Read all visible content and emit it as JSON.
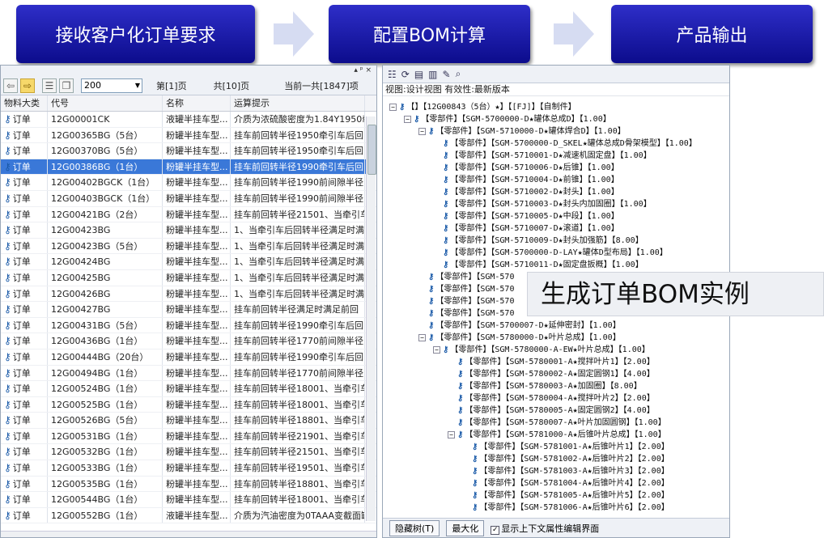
{
  "flow": {
    "step1": "接收客户化订单要求",
    "step2": "配置BOM计算",
    "step3": "产品输出"
  },
  "left": {
    "title_glyphs": "▴ ᵖ ×",
    "page_size": "200",
    "page_cur": "第[1]页",
    "page_total": "共[10]页",
    "record_count": "当前一共[1847]项",
    "columns": [
      "物料大类",
      "代号",
      "名称",
      "运算提示"
    ],
    "rows": [
      {
        "type": "订单",
        "code": "12G00001CK",
        "name": "液罐半挂车型...",
        "hint": "介质为浓硫酸密度为1.84Y1950牵"
      },
      {
        "type": "订单",
        "code": "12G00365BG（5台）",
        "name": "粉罐半挂车型...",
        "hint": "挂车前回转半径1950牵引车后回"
      },
      {
        "type": "订单",
        "code": "12G00370BG（5台）",
        "name": "粉罐半挂车型...",
        "hint": "挂车前回转半径1950牵引车后回"
      },
      {
        "type": "订单",
        "code": "12G00386BG（1台）",
        "name": "粉罐半挂车型...",
        "hint": "挂车前回转半径1990牵引车后回"
      },
      {
        "type": "订单",
        "code": "12G00402BGCK（1台）",
        "name": "粉罐半挂车型...",
        "hint": "挂车前回转半径1990前间隙半径"
      },
      {
        "type": "订单",
        "code": "12G00403BGCK（1台）",
        "name": "粉罐半挂车型...",
        "hint": "挂车前回转半径1990前间隙半径"
      },
      {
        "type": "订单",
        "code": "12G00421BG（2台）",
        "name": "粉罐半挂车型...",
        "hint": "挂车前回转半径21501、当牵引车"
      },
      {
        "type": "订单",
        "code": "12G00423BG",
        "name": "粉罐半挂车型...",
        "hint": "1、当牵引车后回转半径满足时满"
      },
      {
        "type": "订单",
        "code": "12G00423BG（5台）",
        "name": "粉罐半挂车型...",
        "hint": "1、当牵引车后回转半径满足时满"
      },
      {
        "type": "订单",
        "code": "12G00424BG",
        "name": "粉罐半挂车型...",
        "hint": "1、当牵引车后回转半径满足时满"
      },
      {
        "type": "订单",
        "code": "12G00425BG",
        "name": "粉罐半挂车型...",
        "hint": "1、当牵引车后回转半径满足时满"
      },
      {
        "type": "订单",
        "code": "12G00426BG",
        "name": "粉罐半挂车型...",
        "hint": "1、当牵引车后回转半径满足时满"
      },
      {
        "type": "订单",
        "code": "12G00427BG",
        "name": "粉罐半挂车型...",
        "hint": "挂车前回转半径满足时满足前回"
      },
      {
        "type": "订单",
        "code": "12G00431BG（5台）",
        "name": "粉罐半挂车型...",
        "hint": "挂车前回转半径1990牵引车后回"
      },
      {
        "type": "订单",
        "code": "12G00436BG（1台）",
        "name": "粉罐半挂车型...",
        "hint": "挂车前回转半径1770前间隙半径"
      },
      {
        "type": "订单",
        "code": "12G00444BG（20台）",
        "name": "粉罐半挂车型...",
        "hint": "挂车前回转半径1990牵引车后回"
      },
      {
        "type": "订单",
        "code": "12G00494BG（1台）",
        "name": "粉罐半挂车型...",
        "hint": "挂车前回转半径1770前间隙半径"
      },
      {
        "type": "订单",
        "code": "12G00524BG（1台）",
        "name": "粉罐半挂车型...",
        "hint": "挂车前回转半径18001、当牵引车"
      },
      {
        "type": "订单",
        "code": "12G00525BG（1台）",
        "name": "粉罐半挂车型...",
        "hint": "挂车前回转半径18001、当牵引车"
      },
      {
        "type": "订单",
        "code": "12G00526BG（5台）",
        "name": "粉罐半挂车型...",
        "hint": "挂车前回转半径18801、当牵引车"
      },
      {
        "type": "订单",
        "code": "12G00531BG（1台）",
        "name": "粉罐半挂车型...",
        "hint": "挂车前回转半径21901、当牵引车"
      },
      {
        "type": "订单",
        "code": "12G00532BG（1台）",
        "name": "粉罐半挂车型...",
        "hint": "挂车前回转半径21501、当牵引车"
      },
      {
        "type": "订单",
        "code": "12G00533BG（1台）",
        "name": "粉罐半挂车型...",
        "hint": "挂车前回转半径19501、当牵引车"
      },
      {
        "type": "订单",
        "code": "12G00535BG（1台）",
        "name": "粉罐半挂车型...",
        "hint": "挂车前回转半径18801、当牵引车"
      },
      {
        "type": "订单",
        "code": "12G00544BG（1台）",
        "name": "粉罐半挂车型...",
        "hint": "挂车前回转半径18001、当牵引车"
      },
      {
        "type": "订单",
        "code": "12G00552BG（1台）",
        "name": "液罐半挂车型...",
        "hint": "介质为汽油密度为0TAAA变截面罐"
      }
    ]
  },
  "right": {
    "info": "视图:设计视图 有效性:最新版本",
    "tree": [
      {
        "d": 0,
        "e": "−",
        "t": "【】【12G00843（5台）★】【[FJ]】【自制件】"
      },
      {
        "d": 1,
        "e": "−",
        "t": "【零部件】【SGM-5700000-D★罐体总成D】【1.00】"
      },
      {
        "d": 2,
        "e": "−",
        "t": "【零部件】【SGM-5710000-D★罐体焊合D】【1.00】"
      },
      {
        "d": 3,
        "e": "",
        "t": "【零部件】【SGM-5700000-D_SKEL★罐体总成D骨架模型】【1.00】"
      },
      {
        "d": 3,
        "e": "",
        "t": "【零部件】【SGM-5710001-D★减速机固定盘】【1.00】"
      },
      {
        "d": 3,
        "e": "",
        "t": "【零部件】【SGM-5710006-D★后锥】【1.00】"
      },
      {
        "d": 3,
        "e": "",
        "t": "【零部件】【SGM-5710004-D★前锥】【1.00】"
      },
      {
        "d": 3,
        "e": "",
        "t": "【零部件】【SGM-5710002-D★封头】【1.00】"
      },
      {
        "d": 3,
        "e": "",
        "t": "【零部件】【SGM-5710003-D★封头内加固圈】【1.00】"
      },
      {
        "d": 3,
        "e": "",
        "t": "【零部件】【SGM-5710005-D★中段】【1.00】"
      },
      {
        "d": 3,
        "e": "",
        "t": "【零部件】【SGM-5710007-D★滚道】【1.00】"
      },
      {
        "d": 3,
        "e": "",
        "t": "【零部件】【SGM-5710009-D★封头加强筋】【8.00】"
      },
      {
        "d": 3,
        "e": "",
        "t": "【零部件】【SGM-5700000-D-LAY★罐体D型布局】【1.00】"
      },
      {
        "d": 3,
        "e": "",
        "t": "【零部件】【SGM-5710011-D★固定盘扳概】【1.00】"
      },
      {
        "d": 2,
        "e": "",
        "t": "【零部件】【SGM-570"
      },
      {
        "d": 2,
        "e": "",
        "t": "【零部件】【SGM-570"
      },
      {
        "d": 2,
        "e": "",
        "t": "【零部件】【SGM-570"
      },
      {
        "d": 2,
        "e": "",
        "t": "【零部件】【SGM-570"
      },
      {
        "d": 2,
        "e": "",
        "t": "【零部件】【SGM-5700007-D★延伸密封】【1.00】"
      },
      {
        "d": 2,
        "e": "−",
        "t": "【零部件】【SGM-5780000-D★叶片总成】【1.00】"
      },
      {
        "d": 3,
        "e": "−",
        "t": "【零部件】【SGM-5780000-A-EW★叶片总成】【1.00】"
      },
      {
        "d": 4,
        "e": "",
        "t": "【零部件】【SGM-5780001-A★搅拌叶片1】【2.00】"
      },
      {
        "d": 4,
        "e": "",
        "t": "【零部件】【SGM-5780002-A★固定圆钢1】【4.00】"
      },
      {
        "d": 4,
        "e": "",
        "t": "【零部件】【SGM-5780003-A★加固圈】【8.00】"
      },
      {
        "d": 4,
        "e": "",
        "t": "【零部件】【SGM-5780004-A★搅拌叶片2】【2.00】"
      },
      {
        "d": 4,
        "e": "",
        "t": "【零部件】【SGM-5780005-A★固定圆钢2】【4.00】"
      },
      {
        "d": 4,
        "e": "",
        "t": "【零部件】【SGM-5780007-A★叶片加固圆钢】【1.00】"
      },
      {
        "d": 4,
        "e": "−",
        "t": "【零部件】【SGM-5781000-A★后锥叶片总成】【1.00】"
      },
      {
        "d": 5,
        "e": "",
        "t": "【零部件】【SGM-5781001-A★后锥叶片1】【2.00】"
      },
      {
        "d": 5,
        "e": "",
        "t": "【零部件】【SGM-5781002-A★后锥叶片2】【2.00】"
      },
      {
        "d": 5,
        "e": "",
        "t": "【零部件】【SGM-5781003-A★后锥叶片3】【2.00】"
      },
      {
        "d": 5,
        "e": "",
        "t": "【零部件】【SGM-5781004-A★后锥叶片4】【2.00】"
      },
      {
        "d": 5,
        "e": "",
        "t": "【零部件】【SGM-5781005-A★后锥叶片5】【2.00】"
      },
      {
        "d": 5,
        "e": "",
        "t": "【零部件】【SGM-5781006-A★后锥叶片6】【2.00】"
      }
    ],
    "btn_hide": "隐藏树(T)",
    "btn_max": "最大化",
    "cb_label": "显示上下文属性编辑界面"
  },
  "callout": "生成订单BOM实例"
}
